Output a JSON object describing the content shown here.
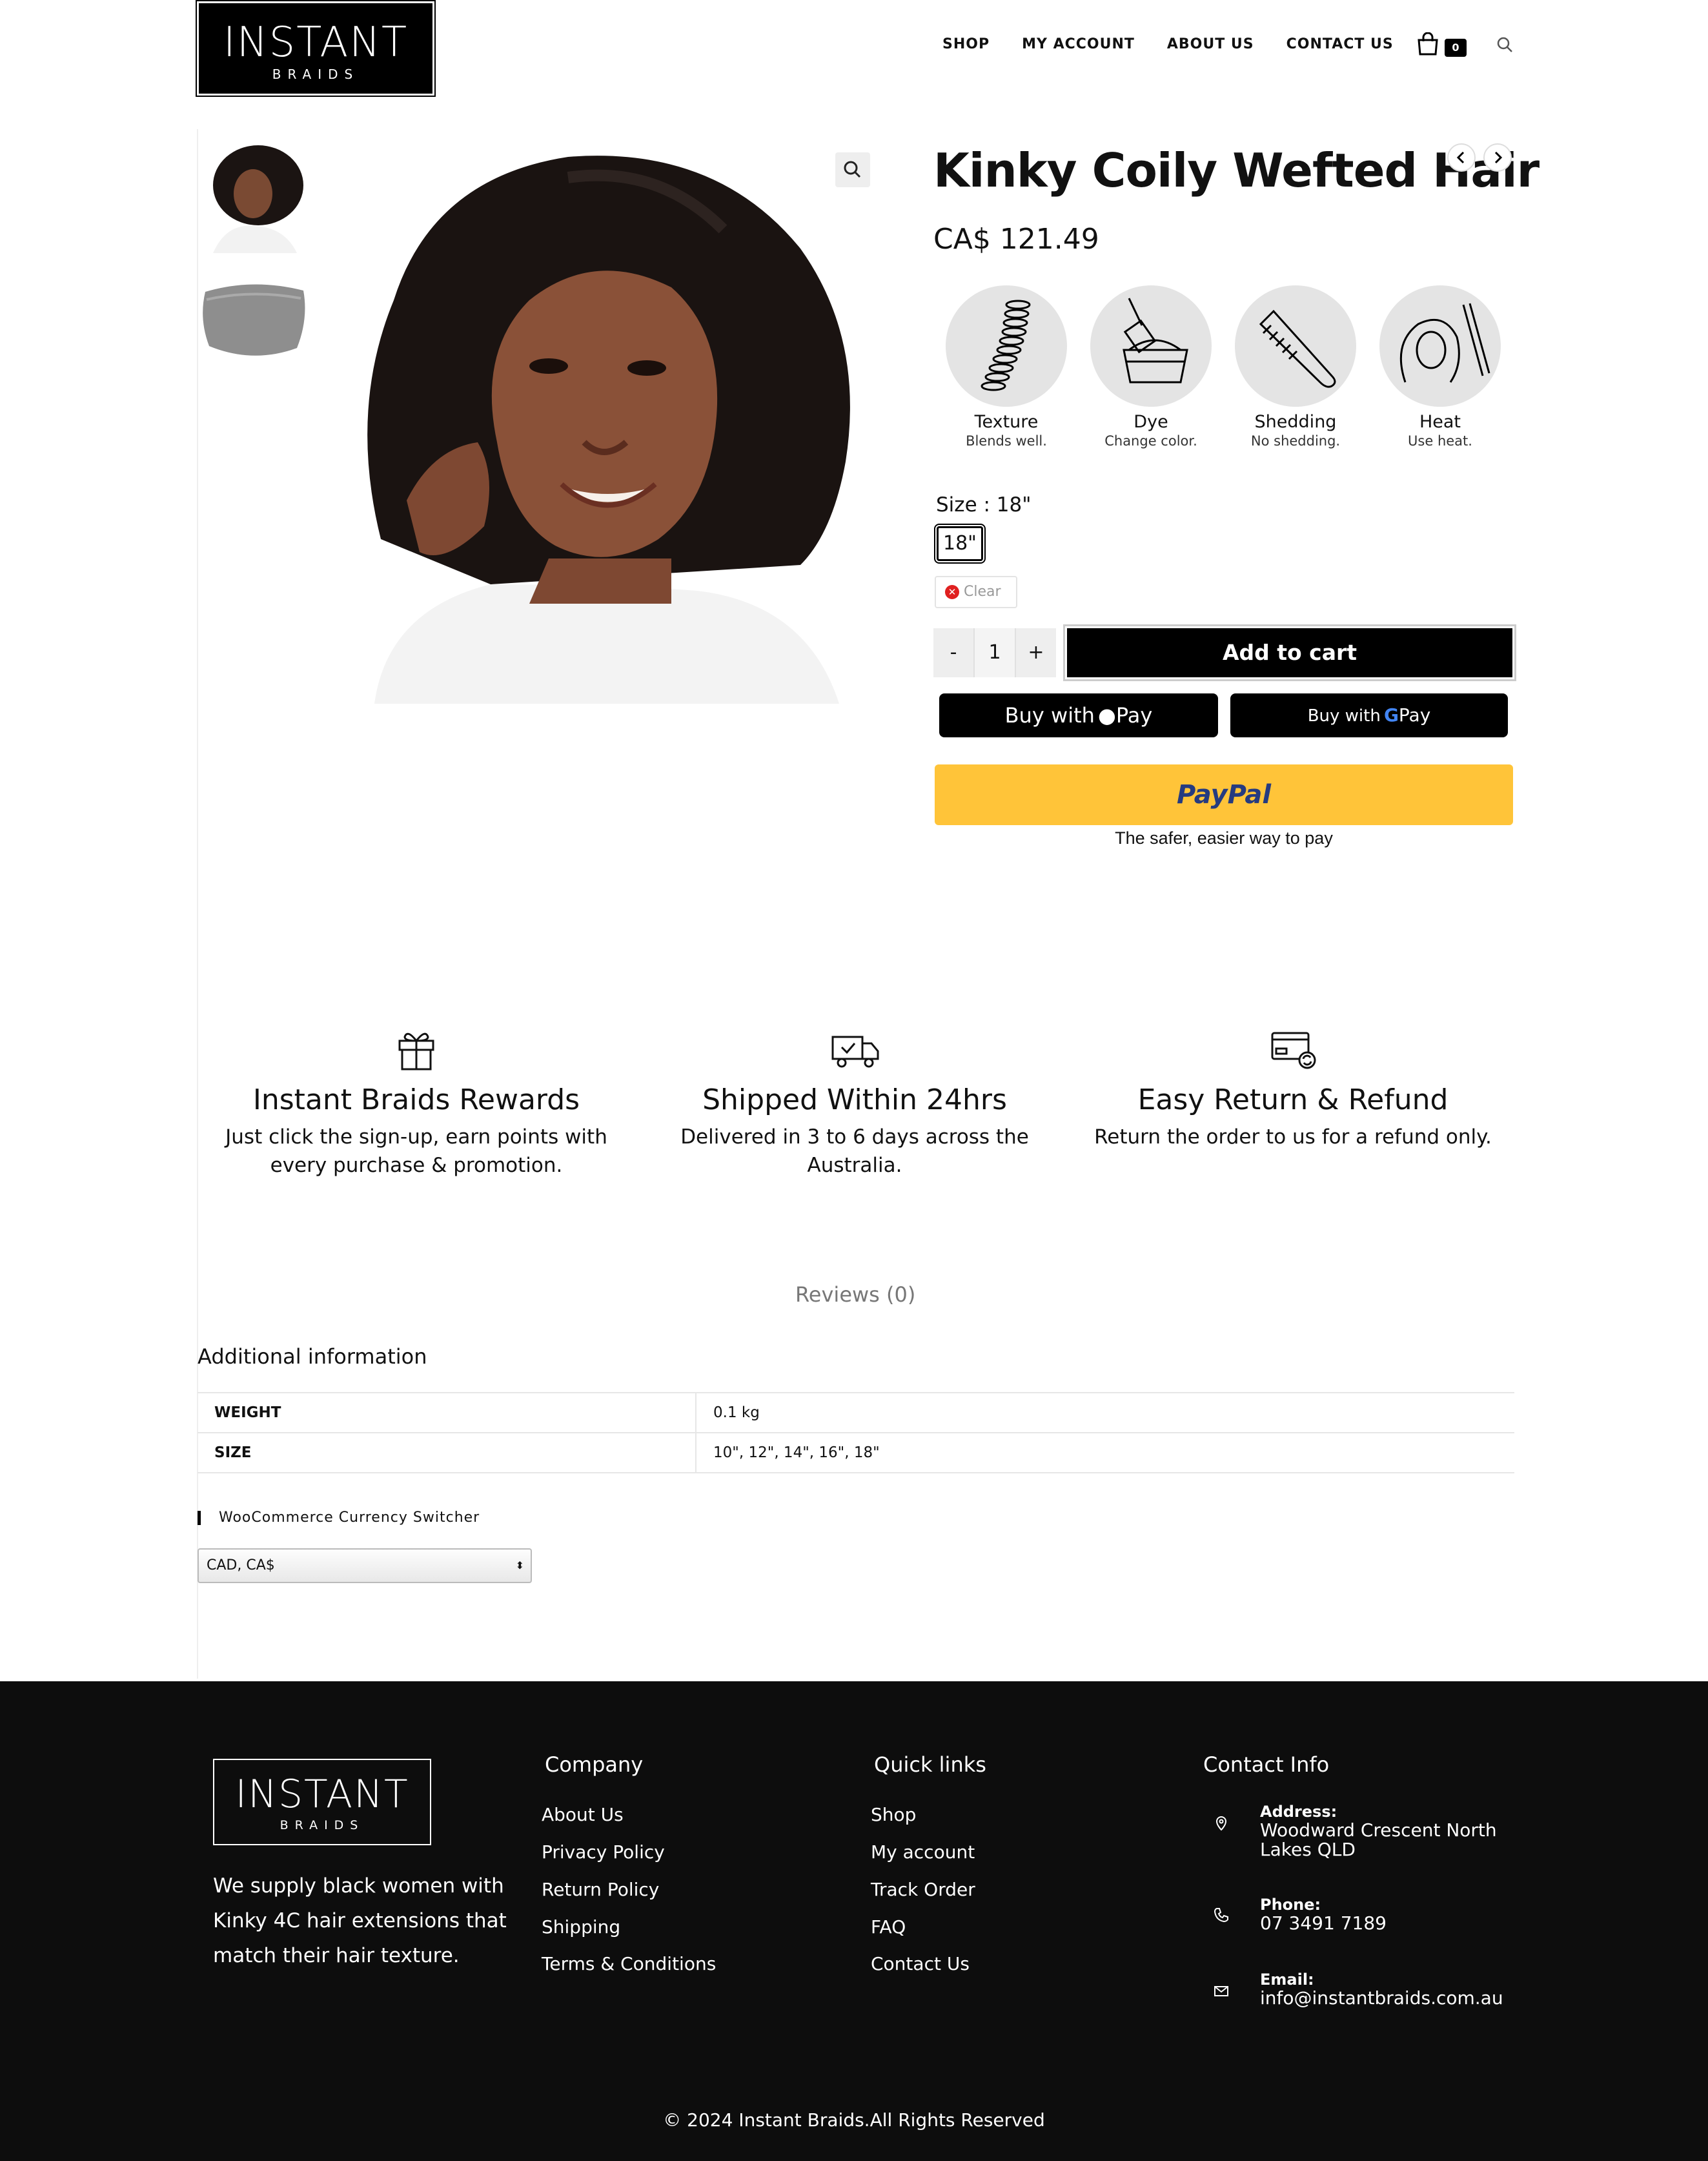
{
  "header": {
    "logo_title": "INSTANT",
    "logo_sub": "BRAIDS",
    "nav": [
      "SHOP",
      "MY ACCOUNT",
      "ABOUT US",
      "CONTACT US"
    ],
    "cart_count": "0"
  },
  "product": {
    "title": "Kinky Coily Wefted Hair",
    "price": "CA$ 121.49",
    "features": [
      {
        "name": "Texture",
        "desc": "Blends well.",
        "icon": "coil-icon"
      },
      {
        "name": "Dye",
        "desc": "Change color.",
        "icon": "dye-bowl-icon"
      },
      {
        "name": "Shedding",
        "desc": "No shedding.",
        "icon": "comb-icon"
      },
      {
        "name": "Heat",
        "desc": "Use heat.",
        "icon": "curling-iron-icon"
      }
    ],
    "size_label": "Size",
    "size_selected": "18\"",
    "size_option": "18\"",
    "clear_label": "Clear",
    "qty_minus": "-",
    "qty_value": "1",
    "qty_plus": "+",
    "add_to_cart": "Add to cart",
    "apple_pay_prefix": "Buy with",
    "apple_pay_suffix": "Pay",
    "google_pay_prefix": "Buy with",
    "google_pay_suffix": "Pay",
    "paypal_label": "PayPal",
    "paypal_tagline": "The safer, easier way to pay"
  },
  "benefits": [
    {
      "title": "Instant Braids Rewards",
      "desc": "Just click the sign-up, earn points with every purchase & promotion.",
      "icon": "gift-icon"
    },
    {
      "title": "Shipped Within 24hrs",
      "desc": "Delivered in 3 to 6 days across the Australia.",
      "icon": "truck-icon"
    },
    {
      "title": "Easy Return & Refund",
      "desc": "Return the order to us for a refund only.",
      "icon": "card-refund-icon"
    }
  ],
  "tabs": {
    "reviews": "Reviews (0)"
  },
  "additional": {
    "title": "Additional information",
    "rows": [
      {
        "key": "WEIGHT",
        "value": "0.1 kg"
      },
      {
        "key": "SIZE",
        "value": "10\", 12\", 14\", 16\", 18\""
      }
    ]
  },
  "currency": {
    "widget_title": "WooCommerce Currency Switcher",
    "selected": "CAD, CA$"
  },
  "footer": {
    "logo_title": "INSTANT",
    "logo_sub": "BRAIDS",
    "about": "We supply black women with Kinky 4C hair extensions that match their hair texture.",
    "company_title": "Company",
    "company_links": [
      "About Us",
      "Privacy Policy",
      "Return Policy",
      "Shipping",
      "Terms & Conditions"
    ],
    "quick_title": "Quick links",
    "quick_links": [
      "Shop",
      "My account",
      "Track Order",
      "FAQ",
      "Contact Us"
    ],
    "contact_title": "Contact Info",
    "address_label": "Address:",
    "address_value": "Woodward Crescent North Lakes QLD",
    "phone_label": "Phone:",
    "phone_value": "07 3491 7189",
    "email_label": "Email:",
    "email_value": "info@instantbraids.com.au",
    "copyright": "© 2024 Instant Braids.All Rights Reserved"
  },
  "colors": {
    "paypal": "#ffc439",
    "footer_bg": "#0d0d0d",
    "accent": "#000000"
  }
}
